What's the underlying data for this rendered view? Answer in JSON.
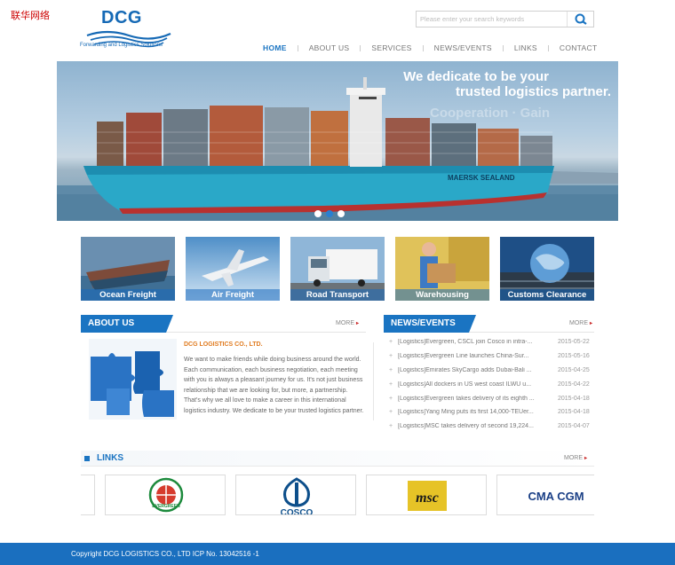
{
  "site_tag": "联华网络",
  "logo": {
    "brand": "DCG",
    "tagline": "Forwarding and Logistics Solutions"
  },
  "search": {
    "placeholder": "Please enter your search keywords",
    "icon": "search-icon"
  },
  "nav": [
    {
      "label": "HOME",
      "active": true
    },
    {
      "label": "ABOUT US",
      "active": false
    },
    {
      "label": "SERVICES",
      "active": false
    },
    {
      "label": "NEWS/EVENTS",
      "active": false
    },
    {
      "label": "LINKS",
      "active": false
    },
    {
      "label": "CONTACT",
      "active": false
    }
  ],
  "banner": {
    "line1": "We dedicate to be your",
    "line2": "trusted logistics partner.",
    "watermark": "Cooperation · Gain",
    "ship_name": "MAERSK SEALAND",
    "slides": 3,
    "active_slide": 2
  },
  "services": [
    {
      "label": "Ocean Freight"
    },
    {
      "label": "Air Freight"
    },
    {
      "label": "Road Transport"
    },
    {
      "label": "Warehousing"
    },
    {
      "label": "Customs Clearance"
    }
  ],
  "about": {
    "header": "ABOUT US",
    "more": "MORE",
    "company": "DCG LOGISTICS CO., LTD.",
    "text": "We want to make friends while doing business around the world. Each communication, each business negotiation, each meeting with you is always a pleasant journey for us. It's not just business relationship that we are looking for, but more, a partnership. That's why we all love to make a career in this international logistics industry. We dedicate to be your trusted logistics partner."
  },
  "news": {
    "header": "NEWS/EVENTS",
    "more": "MORE",
    "items": [
      {
        "title": "[Logistics]Evergreen, CSCL join Cosco in intra-...",
        "date": "2015-05-22"
      },
      {
        "title": "[Logistics]Evergreen Line launches China-Sur...",
        "date": "2015-05-16"
      },
      {
        "title": "[Logistics]Emirates SkyCargo adds Dubai-Bali ...",
        "date": "2015-04-25"
      },
      {
        "title": "[Logistics]All dockers in US west coast ILWU u...",
        "date": "2015-04-22"
      },
      {
        "title": "[Logistics]Evergreen takes delivery of its eighth ...",
        "date": "2015-04-18"
      },
      {
        "title": "[Logistics]Yang Ming puts its first 14,000-TEUer...",
        "date": "2015-04-18"
      },
      {
        "title": "[Logistics]MSC takes delivery of second 19,224...",
        "date": "2015-04-07"
      }
    ]
  },
  "links": {
    "header": "LINKS",
    "more": "MORE",
    "partners": [
      {
        "name": "evergreen-logo",
        "text": "EVERGREEN"
      },
      {
        "name": "cosco-logo",
        "text": "COSCO"
      },
      {
        "name": "msc-logo",
        "text": "msc"
      },
      {
        "name": "cma-cgm-logo",
        "text": "CMA CGM"
      }
    ]
  },
  "footer": {
    "text": "Copyright  DCG LOGISTICS CO., LTD  ICP No. 13042516 -1"
  },
  "colors": {
    "brand_blue": "#1a74c2",
    "footer_blue": "#1a6fbf",
    "accent_orange": "#e07a1e"
  }
}
